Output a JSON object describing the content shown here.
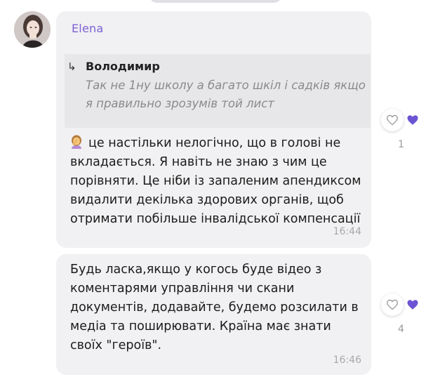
{
  "messages": [
    {
      "sender": "Elena",
      "reply": {
        "arrow": "↳",
        "name": "Володимир",
        "text": "Так не 1ну школу а багато шкіл і садків якщо я правильно зрозумів той лист"
      },
      "emoji": "woman-facepalming-icon",
      "text": "це настільки нелогічно, що в голові не вкладається. Я навіть не знаю з чим це порівняти. Це ніби із запаленим апендиксом видалити декілька здорових органів, щоб отримати побільше інвалідської компенсації",
      "time": "16:44",
      "reaction_count": "1"
    },
    {
      "text": "Будь ласка,якщо у когось буде відео з коментарями управління чи скани документів, додавайте, будемо розсилати в медіа та поширювати. Країна має знати своїх \"героїв\".",
      "time": "16:46",
      "reaction_count": "4"
    }
  ],
  "colors": {
    "sender": "#7b61d6",
    "bubble": "#f1f0f2",
    "reply_bg": "#e7e6e9",
    "heart_filled": "#6c55d3"
  }
}
